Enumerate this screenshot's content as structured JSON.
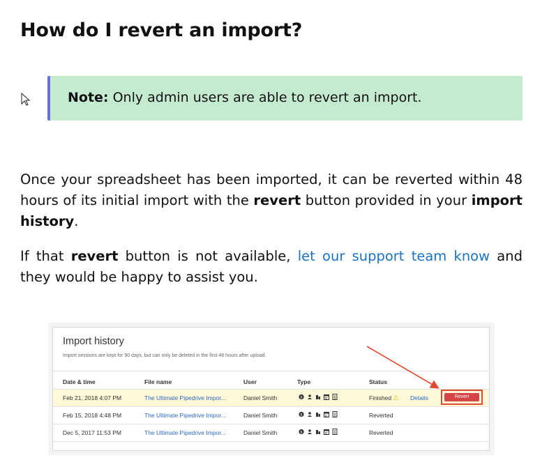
{
  "heading": "How do I revert an import?",
  "note": {
    "label": "Note:",
    "text": " Only admin users are able to revert an import."
  },
  "paragraph1": {
    "part1": "Once your spreadsheet has been imported, it can be reverted within 48 hours of its initial import with the ",
    "bold1": "revert",
    "part2": " button provided in your ",
    "bold2": "import history",
    "part3": "."
  },
  "paragraph2": {
    "part1": "If that ",
    "bold1": "revert",
    "part2": " button is not available, ",
    "link": "let our support team know",
    "part3": " and they would be happy to assist you."
  },
  "screenshot": {
    "title": "Import history",
    "subtitle": "Import sessions are kept for 90 days, but can only be deleted in the first 48 hours after upload.",
    "columns": [
      "Date & time",
      "File name",
      "User",
      "Type",
      "Status"
    ],
    "rows": [
      {
        "date": "Feb 21, 2018 4:07 PM",
        "file": "The Ultimate Pipedrive Impor...",
        "user": "Daniel Smith",
        "status": "Finished",
        "details": "Details",
        "revert": "Revert"
      },
      {
        "date": "Feb 15, 2018 4:48 PM",
        "file": "The Ultimate Pipedrive Impor...",
        "user": "Daniel Smith",
        "status": "Reverted"
      },
      {
        "date": "Dec 5, 2017 11:53 PM",
        "file": "The Ultimate Pipedrive Impor...",
        "user": "Daniel Smith",
        "status": "Reverted"
      }
    ],
    "type_icons": [
      "dollar-icon",
      "person-icon",
      "building-icon",
      "calendar-icon",
      "document-icon"
    ],
    "colors": {
      "highlight_row": "#fdf8d8",
      "revert_button": "#d64545",
      "annotation": "#e04a2f"
    }
  },
  "colors": {
    "note_bg": "#c4ead0",
    "note_border": "#6b6fd6",
    "link": "#1a73c4"
  }
}
